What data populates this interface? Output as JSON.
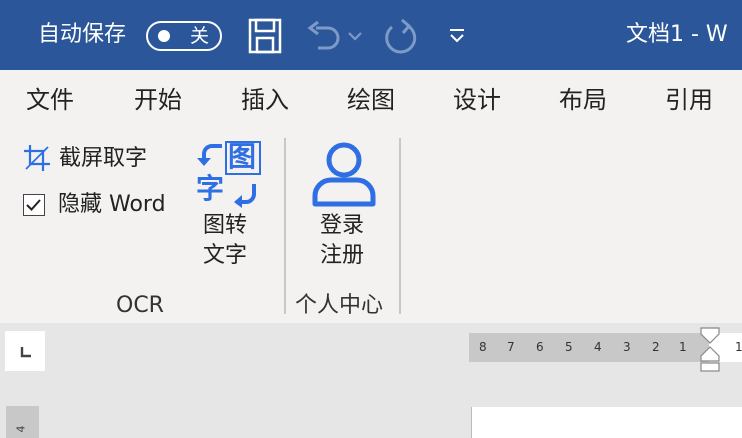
{
  "titlebar": {
    "autosave_label": "自动保存",
    "autosave_state": "关",
    "doc_title": "文档1 - W",
    "icons": [
      "save-icon",
      "undo-icon",
      "chevron-down-icon",
      "redo-icon",
      "customize-dropdown-icon"
    ]
  },
  "tabs": [
    "文件",
    "开始",
    "插入",
    "绘图",
    "设计",
    "布局",
    "引用"
  ],
  "ribbon": {
    "ocr": {
      "screenshot_label": "截屏取字",
      "hide_word_label": "隐藏 Word",
      "hide_word_checked": true,
      "convert_label_line1": "图转",
      "convert_label_line2": "文字",
      "convert_icon_chars": [
        "图",
        "字"
      ],
      "group_label": "OCR"
    },
    "account": {
      "login_label_line1": "登录",
      "login_label_line2": "注册",
      "group_label": "个人中心"
    }
  },
  "ruler": {
    "numbers": [
      "8",
      "7",
      "6",
      "5",
      "4",
      "3",
      "2",
      "1",
      "1"
    ],
    "vertical_number": "4"
  },
  "colors": {
    "titlebar": "#2b579a",
    "ribbon": "#f3f2f1",
    "icon_blue": "#2f6fe4"
  }
}
